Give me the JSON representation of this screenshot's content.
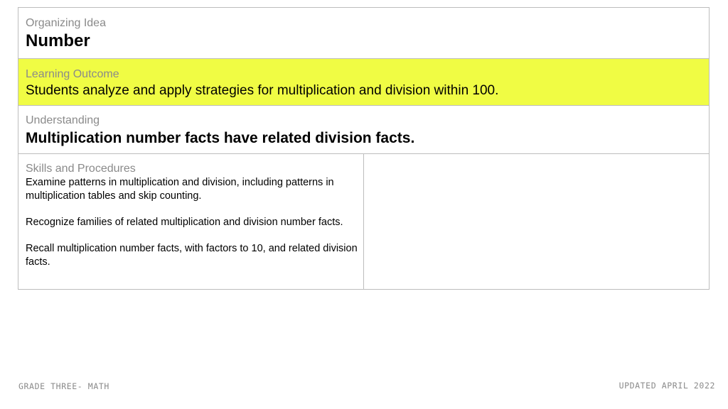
{
  "organizing": {
    "label": "Organizing Idea",
    "value": "Number"
  },
  "outcome": {
    "label": "Learning Outcome",
    "value": "Students analyze and apply strategies for multiplication and division within 100.",
    "highlight_color": "#f0fc44"
  },
  "understanding": {
    "label": "Understanding",
    "value": "Multiplication number facts have related division facts."
  },
  "skills": {
    "label": "Skills and Procedures",
    "items": [
      "Examine patterns in multiplication and division, including patterns in multiplication tables and skip counting.",
      "Recognize families of related multiplication and division number facts.",
      "Recall multiplication number facts, with factors to 10, and related division facts."
    ]
  },
  "footer": {
    "left": "GRADE THREE- MATH",
    "right": "UPDATED APRIL 2022"
  },
  "colors": {
    "border": "#bdbdbd",
    "label": "#8a8a8a"
  }
}
